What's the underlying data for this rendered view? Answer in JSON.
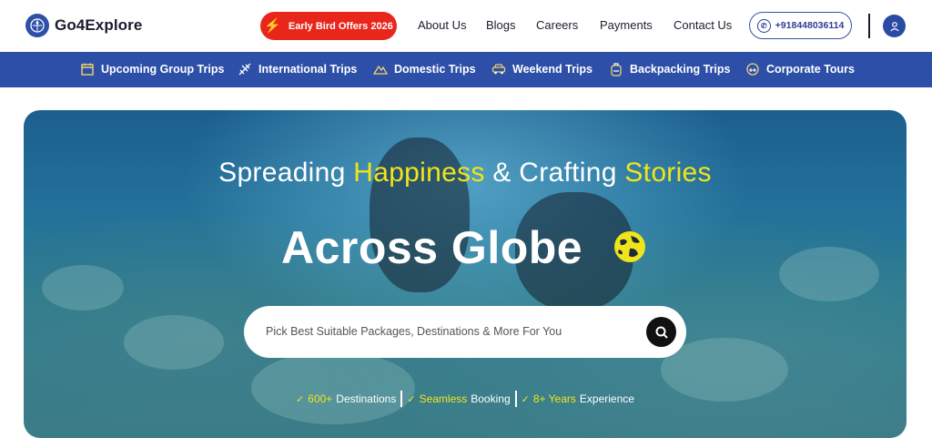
{
  "header": {
    "logo_text": "Go4Explore",
    "offer_label": "Early Bird Offers 2026",
    "nav": [
      "About Us",
      "Blogs",
      "Careers",
      "Payments",
      "Contact Us"
    ],
    "phone": "+918448036114"
  },
  "categories": [
    {
      "label": "Upcoming Group Trips",
      "icon": "calendar-icon"
    },
    {
      "label": "International Trips",
      "icon": "plane-icon"
    },
    {
      "label": "Domestic Trips",
      "icon": "mountain-icon"
    },
    {
      "label": "Weekend Trips",
      "icon": "car-icon"
    },
    {
      "label": "Backpacking Trips",
      "icon": "backpack-icon"
    },
    {
      "label": "Corporate Tours",
      "icon": "briefcase-icon"
    }
  ],
  "hero": {
    "line1_a": "Spreading ",
    "line1_b": "Happiness",
    "line1_c": " & Crafting ",
    "line1_d": "Stories",
    "line2": "Across Globe",
    "search_placeholder": "Pick Best Suitable Packages, Destinations & More For You",
    "stats": [
      {
        "highlight": "600+",
        "text": " Destinations"
      },
      {
        "highlight": "Seamless",
        "text": "Booking"
      },
      {
        "highlight": "8+ Years",
        "text": "Experience"
      }
    ]
  },
  "colors": {
    "brand_blue": "#2d4fa8",
    "offer_red": "#e8261c",
    "highlight_yellow": "#f0e51b"
  }
}
